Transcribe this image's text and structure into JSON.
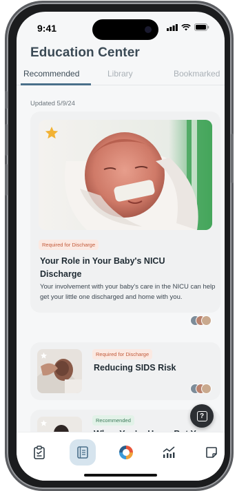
{
  "status": {
    "time": "9:41"
  },
  "header": {
    "title": "Education Center"
  },
  "tabs": [
    {
      "label": "Recommended",
      "active": true
    },
    {
      "label": "Library",
      "active": false
    },
    {
      "label": "Bookmarked",
      "active": false
    }
  ],
  "updated": "Updated 5/9/24",
  "articles": [
    {
      "tag": "Required for Discharge",
      "title": "Your Role in Your Baby's NICU Discharge",
      "description": "Your involvement with your baby's care in the NICU can help get your little one discharged and home with you.",
      "bookmarked": true
    },
    {
      "tag": "Required for Discharge",
      "title": "Reducing SIDS Risk",
      "bookmarked": true
    },
    {
      "tag": "Recommended",
      "title": "When You're Home But Your",
      "bookmarked": true
    }
  ],
  "help_button": {
    "icon": "question-icon",
    "glyph": "?"
  },
  "bottom_nav": [
    {
      "icon": "clipboard-icon",
      "active": false
    },
    {
      "icon": "book-icon",
      "active": true
    },
    {
      "icon": "ring-logo-icon",
      "active": false
    },
    {
      "icon": "growth-chart-icon",
      "active": false
    },
    {
      "icon": "notes-icon",
      "active": false
    }
  ],
  "colors": {
    "accent": "#4a6f8a",
    "tag_red": "#c25b3b",
    "tag_green": "#3d7a5a",
    "star": "#f2b234"
  }
}
